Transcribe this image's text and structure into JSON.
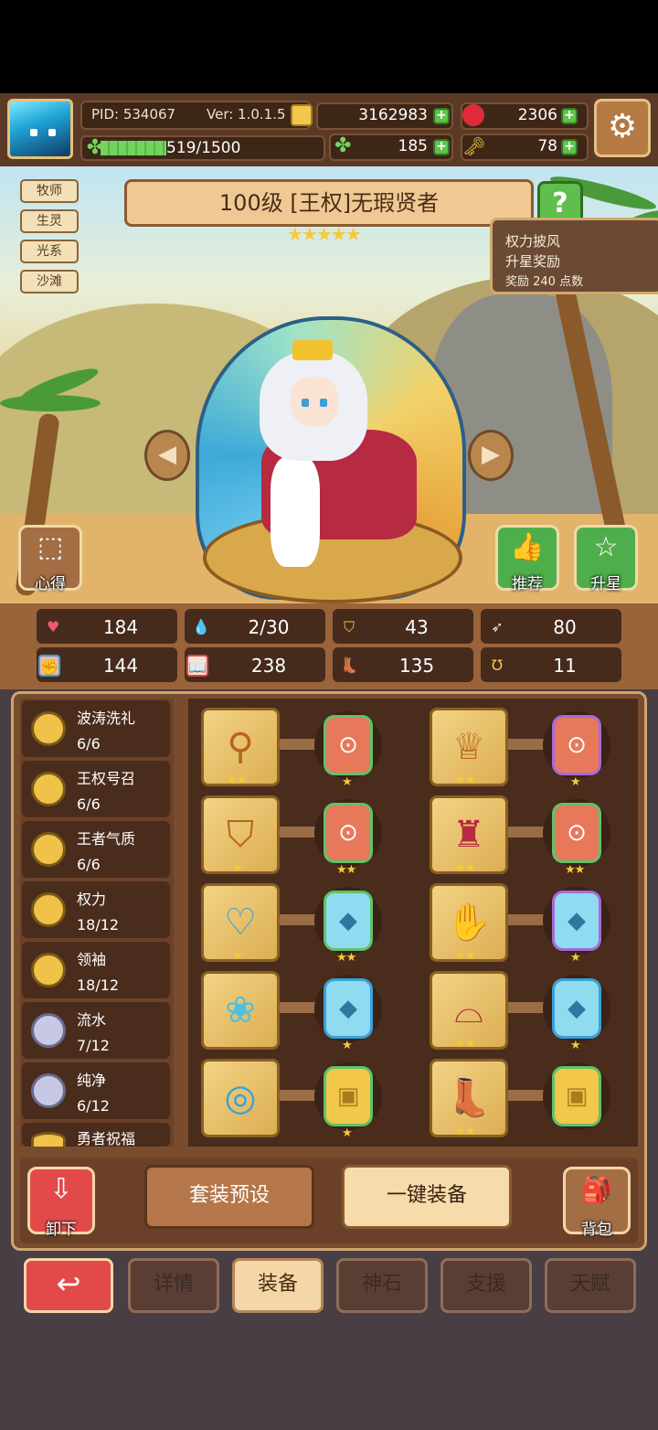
{
  "header": {
    "pid": "PID: 534067",
    "version": "Ver: 1.0.1.5",
    "gold": "3162983",
    "ruby": "2306",
    "xp": "519/1500",
    "xp_fraction": 0.346,
    "clover": "185",
    "key": "78"
  },
  "hero": {
    "title": "100级  [王权]无瑕贤者",
    "stars": "★★★★★",
    "tags": [
      "牧师",
      "生灵",
      "光系",
      "沙滩"
    ],
    "help_icon": "?"
  },
  "reward": {
    "line1": "权力披风",
    "line2": "升星奖励",
    "line3": "奖励 240 点数"
  },
  "scene_buttons": {
    "insight": "心得",
    "recommend": "推荐",
    "star_up": "升星"
  },
  "stats": [
    {
      "icon": "heart-icon",
      "value": "184"
    },
    {
      "icon": "drop-icon",
      "value": "2/30"
    },
    {
      "icon": "shield-icon",
      "value": "43"
    },
    {
      "icon": "wing-icon",
      "value": "80"
    },
    {
      "icon": "fist-icon",
      "value": "144"
    },
    {
      "icon": "book-icon",
      "value": "238"
    },
    {
      "icon": "boot-icon",
      "value": "135"
    },
    {
      "icon": "horseshoe-icon",
      "value": "11"
    }
  ],
  "sets": [
    {
      "name": "波涛洗礼",
      "count": "6/6",
      "coin": "gold"
    },
    {
      "name": "王权号召",
      "count": "6/6",
      "coin": "gold"
    },
    {
      "name": "王者气质",
      "count": "6/6",
      "coin": "gold"
    },
    {
      "name": "权力",
      "count": "18/12",
      "coin": "gold"
    },
    {
      "name": "领袖",
      "count": "18/12",
      "coin": "gold"
    },
    {
      "name": "流水",
      "count": "7/12",
      "coin": "silver"
    },
    {
      "name": "纯净",
      "count": "6/12",
      "coin": "silver"
    },
    {
      "name": "勇者祝福",
      "count": "",
      "coin": "gold"
    }
  ],
  "equipment": [
    {
      "slot": "scepter-icon",
      "slot_stars": "★★",
      "gem": "rune-red",
      "gem_stars": "★"
    },
    {
      "slot": "tiara-icon",
      "slot_stars": "★★",
      "gem": "rune-red-purple",
      "gem_stars": "★"
    },
    {
      "slot": "shield-icon",
      "slot_stars": "★",
      "gem": "rune-red",
      "gem_stars": "★★"
    },
    {
      "slot": "armor-icon",
      "slot_stars": "★★",
      "gem": "rune-red",
      "gem_stars": "★★"
    },
    {
      "slot": "necklace-icon",
      "slot_stars": "★",
      "gem": "gem-blue",
      "gem_stars": "★★"
    },
    {
      "slot": "gloves-icon",
      "slot_stars": "★★",
      "gem": "gem-blue-purple",
      "gem_stars": "★"
    },
    {
      "slot": "orb-icon",
      "slot_stars": "",
      "gem": "gem-blue",
      "gem_stars": "★"
    },
    {
      "slot": "belt-icon",
      "slot_stars": "★★",
      "gem": "gem-blue",
      "gem_stars": "★"
    },
    {
      "slot": "ring-icon",
      "slot_stars": "",
      "gem": "tablet-gold",
      "gem_stars": "★"
    },
    {
      "slot": "boots-icon",
      "slot_stars": "★★",
      "gem": "tablet-gold",
      "gem_stars": ""
    }
  ],
  "actions": {
    "unequip": "卸下",
    "set_preset": "套装预设",
    "one_click_equip": "一键装备",
    "backpack": "背包"
  },
  "tabs": [
    "详情",
    "装备",
    "神石",
    "支援",
    "天赋"
  ],
  "active_tab": "装备",
  "colors": {
    "accent_red": "#e24a4a",
    "wood_dark": "#4a2c1c",
    "gold_star": "#f7c936",
    "green": "#5ec34a"
  }
}
